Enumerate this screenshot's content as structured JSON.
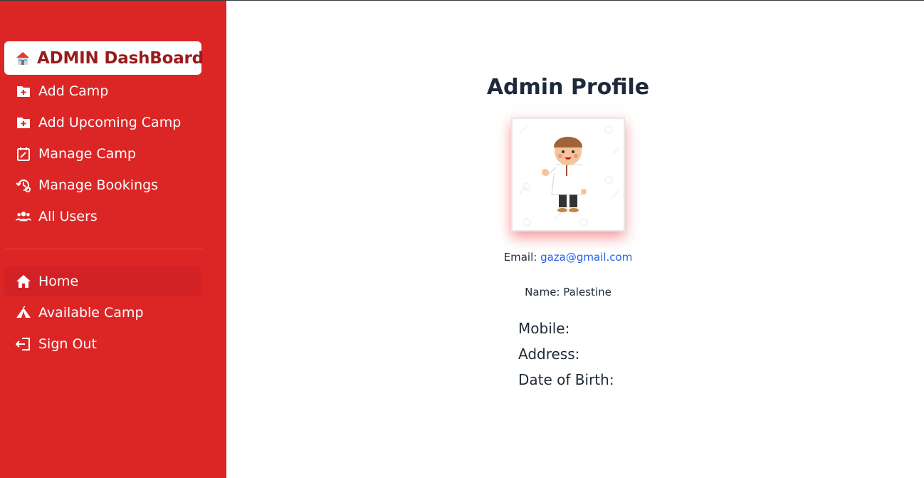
{
  "sidebar": {
    "brand": {
      "label": "ADMIN DashBoard",
      "icon": "house-icon"
    },
    "items": [
      {
        "label": "Add Camp",
        "icon": "folder-plus-icon"
      },
      {
        "label": "Add Upcoming Camp",
        "icon": "folder-plus-icon"
      },
      {
        "label": "Manage Camp",
        "icon": "calendar-edit-icon"
      },
      {
        "label": "Manage Bookings",
        "icon": "history-gear-icon"
      },
      {
        "label": "All Users",
        "icon": "users-icon"
      }
    ],
    "secondary_items": [
      {
        "label": "Home",
        "icon": "home-icon"
      },
      {
        "label": "Available Camp",
        "icon": "tent-icon"
      },
      {
        "label": "Sign Out",
        "icon": "sign-out-icon"
      }
    ]
  },
  "profile": {
    "title": "Admin Profile",
    "email_label": "Email:",
    "email": "gaza@gmail.com",
    "name_label": "Name: Palestine",
    "mobile_label": "Mobile:",
    "address_label": "Address:",
    "dob_label": "Date of Birth:"
  },
  "colors": {
    "sidebar_bg": "#dc2626",
    "brand_text": "#991b1b",
    "link": "#2563eb"
  }
}
